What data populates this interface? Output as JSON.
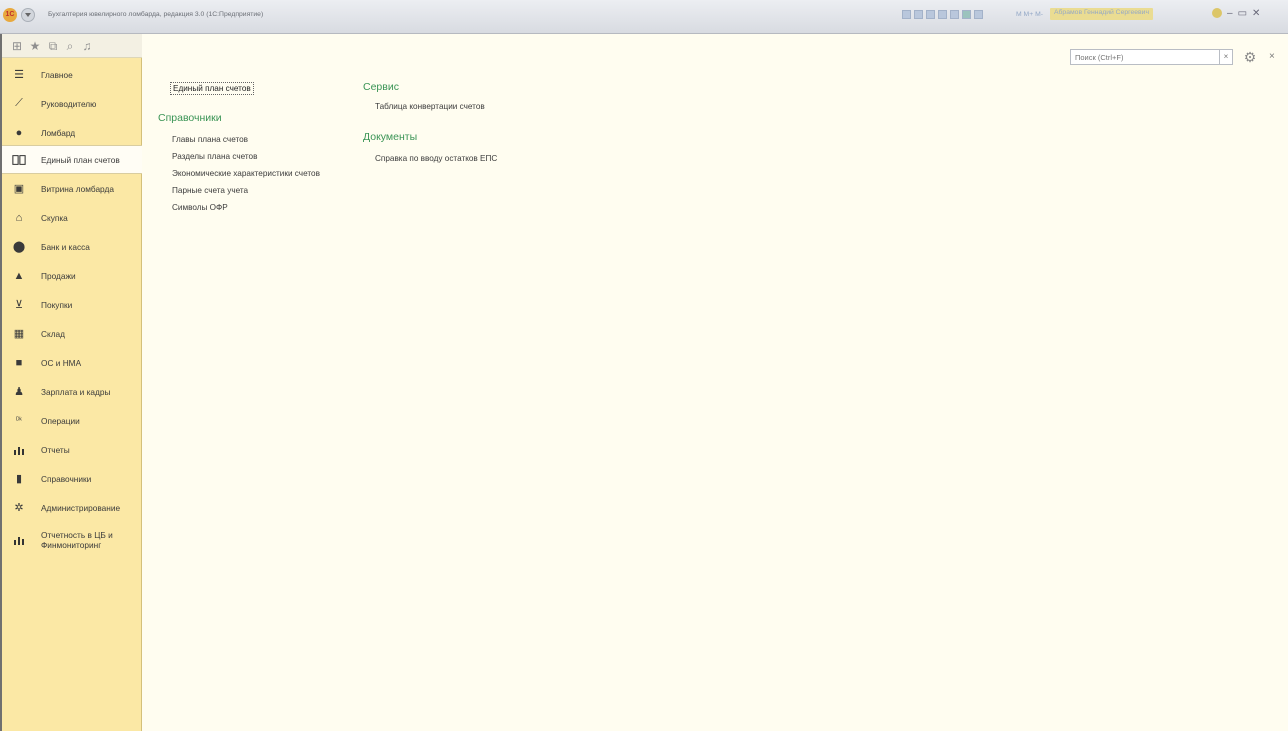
{
  "window": {
    "logo_text": "1С",
    "title": "Бухгалтерия ювелирного ломбарда, редакция 3.0  (1С:Предприятие)",
    "m_text": "M  M+  M-",
    "user": "Абрамов Геннадий Сергеевич",
    "minimize": "–",
    "maximize": "▭",
    "close": "✕"
  },
  "sidebar": {
    "items": [
      {
        "label": "Главное",
        "icon": "menu-lines-icon"
      },
      {
        "label": "Руководителю",
        "icon": "trend-line-icon"
      },
      {
        "label": "Ломбард",
        "icon": "money-bag-icon"
      },
      {
        "label": "Единый план счетов",
        "icon": "open-book-icon"
      },
      {
        "label": "Витрина ломбарда",
        "icon": "showcase-icon"
      },
      {
        "label": "Скупка",
        "icon": "market-icon"
      },
      {
        "label": "Банк и касса",
        "icon": "coin-icon"
      },
      {
        "label": "Продажи",
        "icon": "shopping-bag-icon"
      },
      {
        "label": "Покупки",
        "icon": "cart-icon"
      },
      {
        "label": "Склад",
        "icon": "boxes-icon"
      },
      {
        "label": "ОС и НМА",
        "icon": "truck-icon"
      },
      {
        "label": "Зарплата и кадры",
        "icon": "person-icon"
      },
      {
        "label": "Операции",
        "icon": "dt-kt-icon"
      },
      {
        "label": "Отчеты",
        "icon": "bar-chart-icon"
      },
      {
        "label": "Справочники",
        "icon": "book-icon"
      },
      {
        "label": "Администрирование",
        "icon": "gear-icon"
      },
      {
        "label": "Отчетность в ЦБ и\nФинмониторинг",
        "icon": "bar-chart-icon"
      }
    ],
    "active_index": 3
  },
  "main": {
    "search_placeholder": "Поиск (Ctrl+F)",
    "clear_label": "×",
    "close_label": "×",
    "col1": {
      "top_link": "Единый план счетов",
      "section_title": "Справочники",
      "links": [
        "Главы плана счетов",
        "Разделы плана счетов",
        "Экономические характеристики счетов",
        "Парные счета учета",
        "Символы ОФР"
      ]
    },
    "col2": {
      "service_title": "Сервис",
      "service_links": [
        "Таблица конвертации счетов"
      ],
      "docs_title": "Документы",
      "docs_links": [
        "Справка по вводу остатков ЕПС"
      ]
    }
  },
  "colors": {
    "sidebar_bg": "#fbe8a5",
    "main_bg": "#fffdf0",
    "section_title": "#3a9455"
  }
}
